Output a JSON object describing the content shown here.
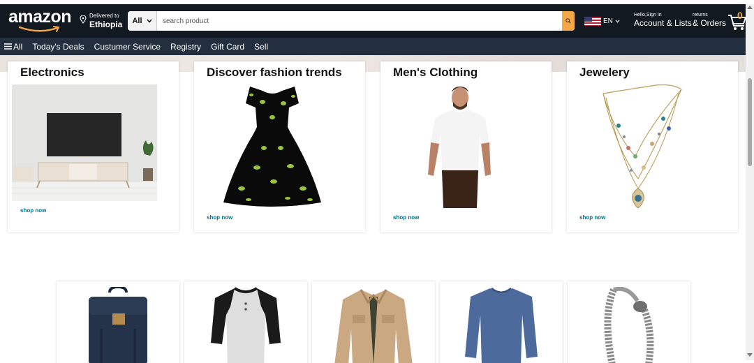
{
  "header": {
    "logo_text": "amazon",
    "deliver_label": "Delivered to",
    "deliver_location": "Ethiopia",
    "search_category": "All",
    "search_placeholder": "search product",
    "language": "EN",
    "account_greeting": "Hello,Sign In",
    "account_label": "Account & Lists",
    "returns_label": "returns",
    "orders_label": "& Orders",
    "cart_count": "0"
  },
  "subnav": {
    "items": [
      "All",
      "Today's Deals",
      "Custumer Service",
      "Registry",
      "Gift Card",
      "Sell"
    ]
  },
  "cards": [
    {
      "title": "Electronics",
      "link": "shop now",
      "image": "tv-stand-image"
    },
    {
      "title": "Discover fashion trends",
      "link": "shop now",
      "image": "dress-image"
    },
    {
      "title": "Men's Clothing",
      "link": "shop now",
      "image": "man-tshirt-image"
    },
    {
      "title": "Jewelery",
      "link": "shop now",
      "image": "necklace-image"
    }
  ],
  "products": [
    {
      "image": "backpack-image"
    },
    {
      "image": "raglan-shirt-image"
    },
    {
      "image": "jacket-image"
    },
    {
      "image": "blue-shirt-image"
    },
    {
      "image": "bracelet-image"
    }
  ],
  "colors": {
    "header_bg": "#131921",
    "subnav_bg": "#232f3e",
    "search_btn": "#f3a847",
    "link": "#007185"
  }
}
